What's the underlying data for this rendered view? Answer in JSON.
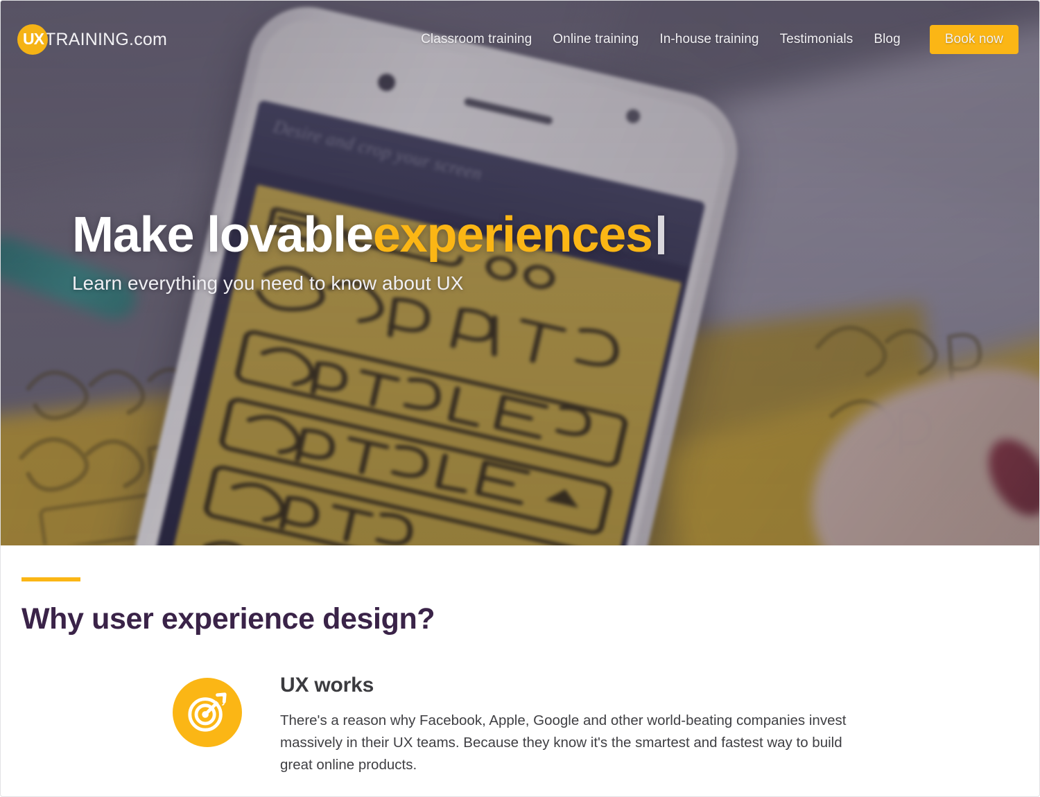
{
  "brand": {
    "badge_text": "UX",
    "word": "TRAINING.com",
    "badge_color": "#F5B315"
  },
  "nav": {
    "items": [
      {
        "label": "Classroom training"
      },
      {
        "label": "Online training"
      },
      {
        "label": "In-house training"
      },
      {
        "label": "Testimonials"
      },
      {
        "label": "Blog"
      }
    ],
    "cta": {
      "label": "Book now",
      "bg": "#FBB615",
      "text_color": "#2f2a38"
    }
  },
  "hero": {
    "title_plain": "Make lovable ",
    "title_accent": "experiences",
    "accent_color": "#FBB615",
    "subtitle": "Learn everything you need to know about UX",
    "caret_visible": true,
    "photo_caption_faint": "Desire and crop your screen",
    "sticky_note_lines": [
      "BOOK YOUR TRIP",
      "RETURN | ONE WAY",
      "OUTBOUND",
      "RETURN"
    ]
  },
  "section": {
    "accent_rule_color": "#FBB615",
    "title": "Why user experience design?",
    "features": [
      {
        "icon": "target-bullseye-icon",
        "title": "UX works",
        "text": "There's a reason why Facebook, Apple, Google and other world-beating companies invest massively in their UX teams. Because they know it's the smartest and fastest way to build great online products."
      }
    ]
  }
}
